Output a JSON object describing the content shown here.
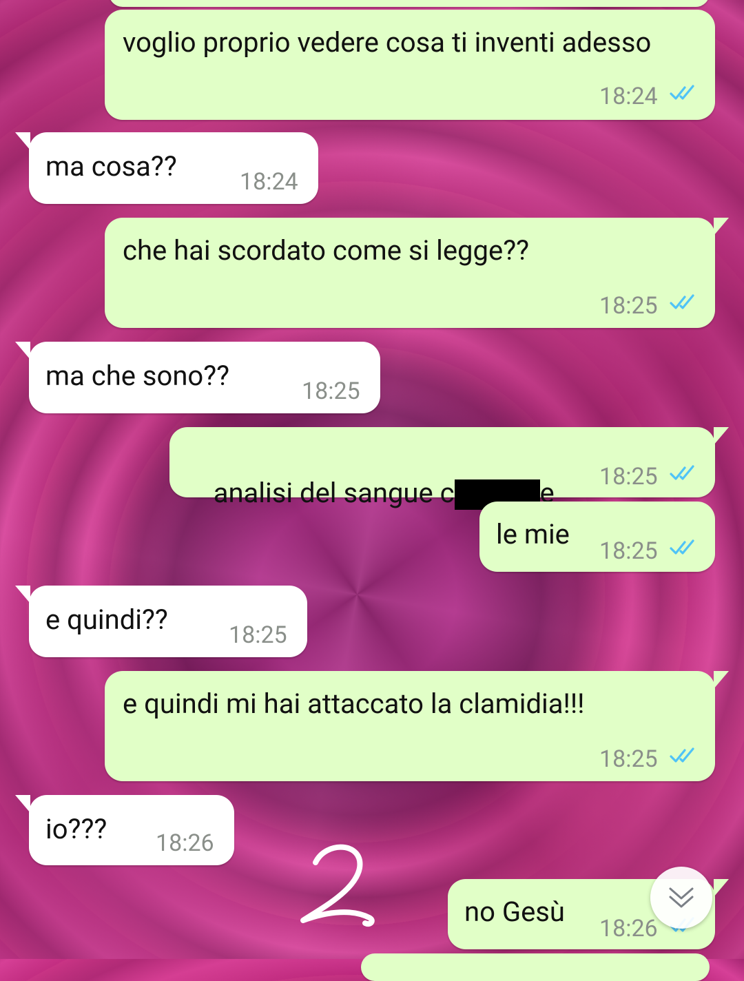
{
  "messages": [
    {
      "direction": "out",
      "text": "voglio proprio vedere cosa ti inventi adesso",
      "time": "18:24",
      "status": "read"
    },
    {
      "direction": "in",
      "text": "ma cosa??",
      "time": "18:24"
    },
    {
      "direction": "out",
      "text": "che hai scordato come si legge??",
      "time": "18:25",
      "status": "read"
    },
    {
      "direction": "in",
      "text": "ma che sono??",
      "time": "18:25"
    },
    {
      "direction": "out",
      "text_before": "analisi del sangue c",
      "text_after": "e",
      "time": "18:25",
      "status": "read",
      "redacted": true
    },
    {
      "direction": "out",
      "text": "le mie",
      "time": "18:25",
      "status": "read"
    },
    {
      "direction": "in",
      "text": "e quindi??",
      "time": "18:25"
    },
    {
      "direction": "out",
      "text": "e quindi mi hai attaccato la clamidia!!!",
      "time": "18:25",
      "status": "read"
    },
    {
      "direction": "in",
      "text": "io???",
      "time": "18:26"
    },
    {
      "direction": "out",
      "text": "no Gesù",
      "time": "18:26",
      "status": "read"
    }
  ],
  "overlay": {
    "annotation": "2"
  },
  "colors": {
    "outgoing": "#e1ffc7",
    "incoming": "#ffffff",
    "read_ticks": "#4fc3f7",
    "timestamp": "#8a8f8a"
  },
  "icons": {
    "ticks": "double-check-icon",
    "scroll": "chevron-double-down-icon"
  }
}
